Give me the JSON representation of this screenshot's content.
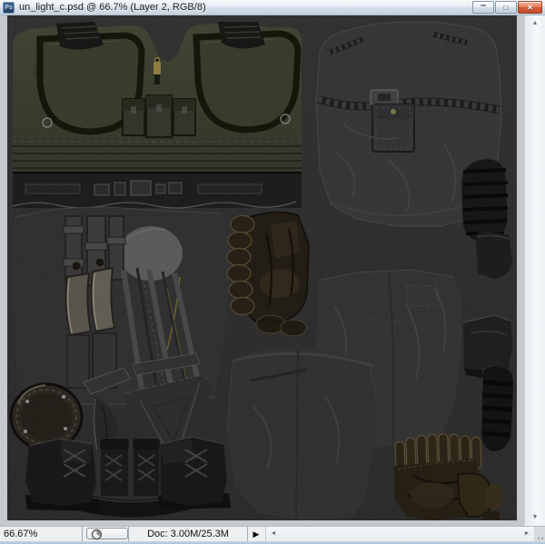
{
  "window": {
    "app_icon_label": "Ps",
    "title": "un_light_c.psd @ 66.7% (Layer 2, RGB/8)",
    "controls": {
      "minimize_glyph": "–",
      "maximize_glyph": "□",
      "close_glyph": "✕"
    }
  },
  "canvas": {
    "description": "Dark UV texture atlas of a military costume: olive tactical vest, jacket back, pants, leather straps, gloves with finger segments, boots, boot soles and knee pad on a dark gray background",
    "background_color": "#2b2b2b",
    "pieces": [
      "vest-front-piece",
      "belt-strip-piece",
      "jacket-back-piece",
      "boot-sole-piece-1",
      "small-pad-piece",
      "pants-front-piece",
      "glove-left-piece",
      "leg-piece-upper",
      "leg-piece-lower",
      "boot-side-piece",
      "boot-sole-piece-2",
      "knee-pad-piece",
      "shin-curve-piece",
      "strap-pieces",
      "cap-piece",
      "boots-pair-piece",
      "glove-right-piece"
    ]
  },
  "statusbar": {
    "zoom_value": "66.67%",
    "doc_info": "Doc: 3.00M/25.3M",
    "menu_arrow_glyph": "▶"
  },
  "scrollbars": {
    "up_glyph": "▲",
    "down_glyph": "▼",
    "left_glyph": "◄",
    "right_glyph": "►"
  },
  "colors": {
    "frame": "#c6c9cb",
    "titlebar_gradient_top": "#f7fafc",
    "titlebar_gradient_bottom": "#c8d5e1",
    "close_button": "#d65c38",
    "canvas_bg": "#2b2b2b",
    "vest_olive": "#3a3d2c",
    "gray_blob": "#585858"
  }
}
